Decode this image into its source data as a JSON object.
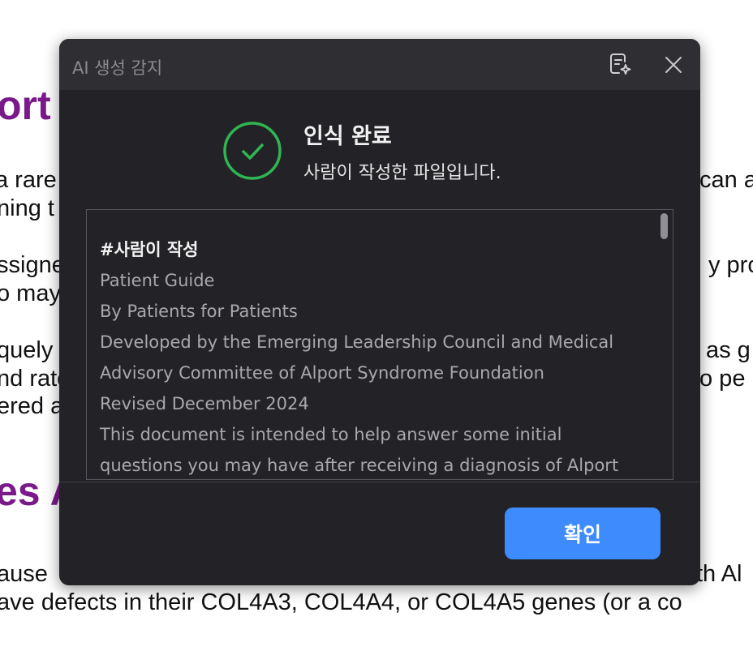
{
  "background": {
    "heading1": "ort",
    "heading2": "es A",
    "text_left": [
      "a rare",
      "ning t",
      "ssigne",
      "o may",
      "quely",
      "nd rate",
      "ered a",
      "ause"
    ],
    "text_right": [
      "can a",
      "y prog",
      "as g",
      "o pe",
      "th Al"
    ],
    "text_bottom": "ave defects in their COL4A3, COL4A4, or COL4A5 genes (or a co"
  },
  "dialog": {
    "title": "AI 생성 감지",
    "ai_icon": "document-sparkle-icon",
    "close_icon": "close-icon",
    "status": {
      "icon": "check-circle-icon",
      "color": "#2fb551",
      "title": "인식 완료",
      "subtitle": "사람이 작성한 파일입니다."
    },
    "content": {
      "tag": "#사람이 작성",
      "lines": [
        "Patient Guide",
        "By Patients for Patients",
        "Developed by the Emerging Leadership Council and Medical",
        "Advisory Committee of Alport Syndrome Foundation",
        "Revised December 2024",
        "This document is intended to help answer some initial",
        "questions you may have after receiving a diagnosis of Alport"
      ]
    },
    "confirm_label": "확인",
    "accent_color": "#3d8bfd"
  }
}
